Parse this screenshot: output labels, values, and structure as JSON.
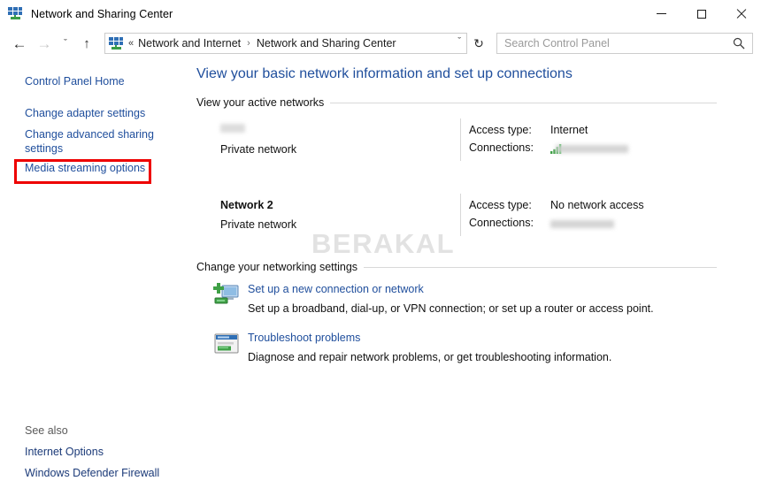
{
  "window": {
    "title": "Network and Sharing Center",
    "icon": "network-sharing-icon",
    "controls": {
      "minimize": "minimize-icon",
      "maximize": "maximize-icon",
      "close": "close-icon"
    }
  },
  "toolbar": {
    "back": "←",
    "forward": "→",
    "recent": "ˇ",
    "up": "↑",
    "refresh": "↻",
    "breadcrumb": {
      "overflow": "«",
      "items": [
        "Network and Internet",
        "Network and Sharing Center"
      ],
      "separator": "›",
      "dropdown": "ˇ"
    }
  },
  "search": {
    "placeholder": "Search Control Panel",
    "value": "",
    "icon": "search-icon"
  },
  "sidebar": {
    "items": [
      {
        "label": "Control Panel Home",
        "highlighted": false
      },
      {
        "label": "Change adapter settings",
        "highlighted": true
      },
      {
        "label": "Change advanced sharing settings",
        "highlighted": false
      },
      {
        "label": "Media streaming options",
        "highlighted": false
      }
    ],
    "highlight_color": "#ee0000",
    "see_also": {
      "title": "See also",
      "links": [
        "Internet Options",
        "Windows Defender Firewall"
      ]
    }
  },
  "main": {
    "heading": "View your basic network information and set up connections",
    "sections": {
      "active_networks": "View your active networks",
      "change_settings": "Change your networking settings"
    },
    "networks": [
      {
        "name": "",
        "name_blurred": true,
        "type": "Private network",
        "access_type_label": "Access type:",
        "access_type_value": "Internet",
        "connections_label": "Connections:",
        "connections_value": "",
        "connections_blurred": true,
        "has_signal_icon": true
      },
      {
        "name": "Network 2",
        "name_blurred": false,
        "type": "Private network",
        "access_type_label": "Access type:",
        "access_type_value": "No network access",
        "connections_label": "Connections:",
        "connections_value": "",
        "connections_blurred": true,
        "has_signal_icon": false
      }
    ],
    "tasks": [
      {
        "icon": "new-connection-icon",
        "title": "Set up a new connection or network",
        "description": "Set up a broadband, dial-up, or VPN connection; or set up a router or access point."
      },
      {
        "icon": "troubleshoot-icon",
        "title": "Troubleshoot problems",
        "description": "Diagnose and repair network problems, or get troubleshooting information."
      }
    ]
  },
  "watermark": {
    "text": "BERAKAL",
    "color": "#e2e2e2"
  },
  "colors": {
    "link_blue": "#1f4e9c",
    "see_also_blue": "#1b3a78",
    "highlight_red": "#ee0000",
    "rule_gray": "#d8d8d8"
  }
}
